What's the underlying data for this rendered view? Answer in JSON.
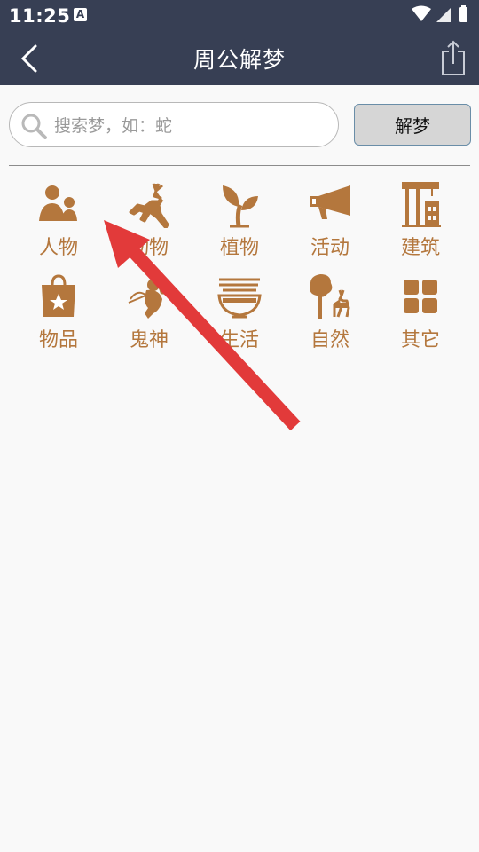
{
  "status_bar": {
    "time": "11:25",
    "notification_badge": "A"
  },
  "header": {
    "title": "周公解梦",
    "back_icon": "chevron-left-icon",
    "share_icon": "share-icon"
  },
  "search": {
    "placeholder": "搜索梦，如：蛇",
    "value": "",
    "button_label": "解梦"
  },
  "categories": [
    {
      "label": "人物",
      "icon": "people-icon"
    },
    {
      "label": "动物",
      "icon": "deer-icon"
    },
    {
      "label": "植物",
      "icon": "sprout-icon"
    },
    {
      "label": "活动",
      "icon": "megaphone-icon"
    },
    {
      "label": "建筑",
      "icon": "construction-icon"
    },
    {
      "label": "物品",
      "icon": "shopping-bag-icon"
    },
    {
      "label": "鬼神",
      "icon": "cupid-icon"
    },
    {
      "label": "生活",
      "icon": "noodle-bowl-icon"
    },
    {
      "label": "自然",
      "icon": "tree-deer-icon"
    },
    {
      "label": "其它",
      "icon": "grid-icon"
    }
  ],
  "colors": {
    "header_bg": "#373f54",
    "accent": "#b4773d",
    "annotation_arrow": "#e23a3a"
  }
}
